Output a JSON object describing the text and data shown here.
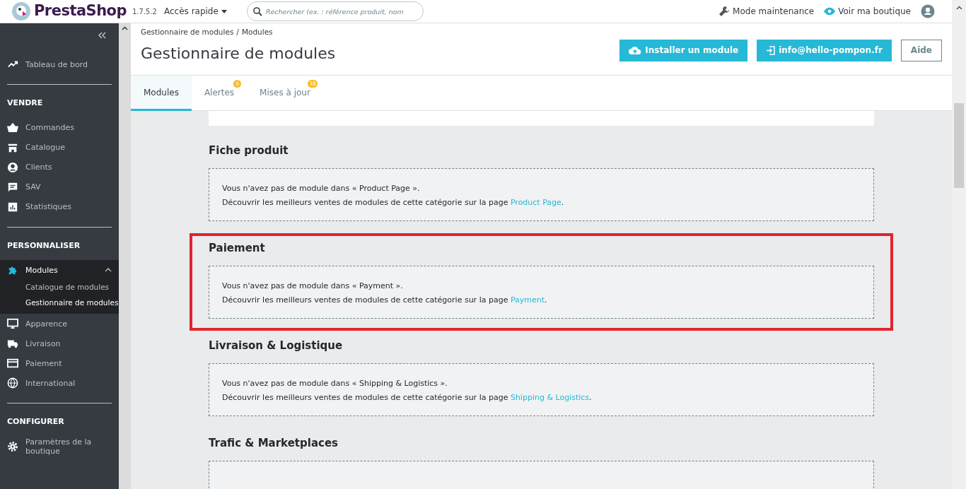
{
  "topbar": {
    "logo": "PrestaShop",
    "version": "1.7.5.2",
    "quick_access": "Accès rapide",
    "search": {
      "placeholder": "Rechercher (ex. : référence produit, nom"
    },
    "links": [
      {
        "kind": "maintenance",
        "label": "Mode maintenance"
      },
      {
        "kind": "shop",
        "label": "Voir ma boutique"
      }
    ]
  },
  "sidebar": {
    "sections": [
      {
        "items": [
          {
            "kind": "trend",
            "label": "Tableau de bord",
            "selected": false
          }
        ]
      },
      {
        "title": "VENDRE",
        "items": [
          {
            "kind": "basket",
            "label": "Commandes",
            "selected": false
          },
          {
            "kind": "store",
            "label": "Catalogue",
            "selected": false
          },
          {
            "kind": "user",
            "label": "Clients",
            "selected": false
          },
          {
            "kind": "chat",
            "label": "SAV",
            "selected": false
          },
          {
            "kind": "stats",
            "label": "Statistiques",
            "selected": false
          }
        ]
      },
      {
        "title": "PERSONNALISER",
        "items": [
          {
            "kind": "puzzle",
            "label": "Modules",
            "selected": true,
            "expanded": true,
            "children": [
              {
                "label": "Catalogue de modules",
                "selected": false
              },
              {
                "label": "Gestionnaire de modules",
                "selected": true
              }
            ]
          },
          {
            "kind": "monitor",
            "label": "Apparence",
            "selected": false
          },
          {
            "kind": "truck",
            "label": "Livraison",
            "selected": false
          },
          {
            "kind": "card",
            "label": "Paiement",
            "selected": false
          },
          {
            "kind": "globe",
            "label": "International",
            "selected": false
          }
        ]
      },
      {
        "title": "CONFIGURER",
        "items": [
          {
            "kind": "gear",
            "label": "Paramètres de la boutique",
            "selected": false
          }
        ]
      }
    ]
  },
  "header": {
    "breadcrumb": [
      "Gestionnaire de modules",
      "Modules"
    ],
    "breadcrumb_separator": "/",
    "title": "Gestionnaire de modules",
    "buttons": [
      {
        "kind": "upload",
        "label": "Installer un module"
      },
      {
        "kind": "login",
        "label": "info@hello-pompon.fr"
      },
      {
        "kind": "outline",
        "label": "Aide"
      }
    ]
  },
  "tabs": [
    {
      "label": "Modules",
      "selected": true
    },
    {
      "label": "Alertes",
      "selected": false,
      "badge": "0"
    },
    {
      "label": "Mises à jour",
      "selected": false,
      "badge": "38"
    }
  ],
  "sections": [
    {
      "title": "Fiche produit",
      "highlighted": false,
      "message": "Vous n'avez pas de module dans « Product Page ».",
      "discover": "Découvrir les meilleurs ventes de modules de cette catégorie sur la page",
      "link": "Product Page",
      "suffix": "."
    },
    {
      "title": "Paiement",
      "highlighted": true,
      "message": "Vous n'avez pas de module dans « Payment ».",
      "discover": "Découvrir les meilleurs ventes de modules de cette catégorie sur la page",
      "link": "Payment",
      "suffix": "."
    },
    {
      "title": "Livraison & Logistique",
      "highlighted": false,
      "message": "Vous n'avez pas de module dans « Shipping & Logistics ».",
      "discover": "Découvrir les meilleurs ventes de modules de cette catégorie sur la page",
      "link": "Shipping & Logistics",
      "suffix": "."
    },
    {
      "title": "Trafic & Marketplaces",
      "highlighted": false
    }
  ]
}
